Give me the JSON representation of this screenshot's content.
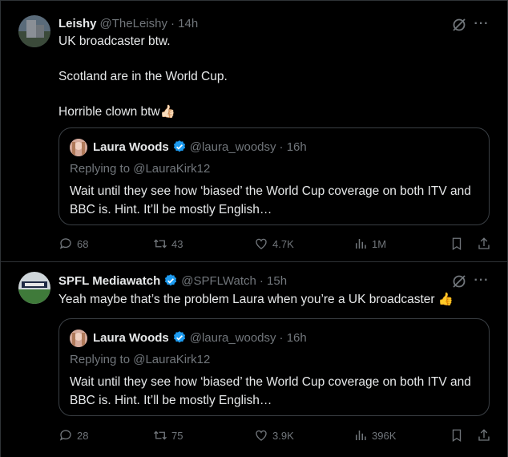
{
  "tweets": [
    {
      "name": "Leishy",
      "handle": "@TheLeishy",
      "time": "· 14h",
      "text": "UK broadcaster btw.\n\nScotland are in the World Cup.\n\nHorrible clown btw👍🏻",
      "verified": false,
      "quote": {
        "name": "Laura Woods",
        "handle": "@laura_woodsy",
        "time": "· 16h",
        "replying": "Replying to @LauraKirk12",
        "text": "Wait until they see how ‘biased’ the World Cup coverage on both ITV and BBC is. Hint. It’ll be mostly English…"
      },
      "stats": {
        "replies": "68",
        "retweets": "43",
        "likes": "4.7K",
        "views": "1M"
      }
    },
    {
      "name": "SPFL Mediawatch",
      "handle": "@SPFLWatch",
      "time": "· 15h",
      "text": "Yeah maybe that’s the problem Laura when you’re a UK broadcaster 👍",
      "verified": true,
      "quote": {
        "name": "Laura Woods",
        "handle": "@laura_woodsy",
        "time": "· 16h",
        "replying": "Replying to @LauraKirk12",
        "text": "Wait until they see how ‘biased’ the World Cup coverage on both ITV and BBC is. Hint. It’ll be mostly English…"
      },
      "stats": {
        "replies": "28",
        "retweets": "75",
        "likes": "3.9K",
        "views": "396K"
      }
    }
  ],
  "icons": {
    "more": "more-icon",
    "grok": "grok-icon",
    "reply": "reply-icon",
    "retweet": "retweet-icon",
    "like": "like-icon",
    "views": "views-icon",
    "bookmark": "bookmark-icon",
    "share": "share-icon"
  },
  "colors": {
    "verified": "#1d9bf0",
    "muted": "#71767b",
    "text": "#e7e9ea",
    "border": "#2f3336"
  }
}
